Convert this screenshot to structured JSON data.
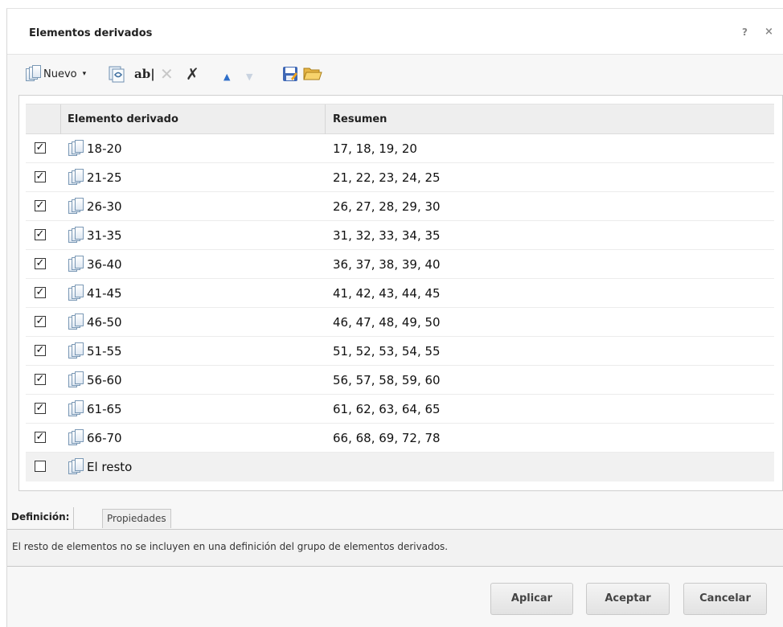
{
  "dialog": {
    "title": "Elementos derivados",
    "help_label": "?",
    "close_label": "×"
  },
  "toolbar": {
    "new_label": "Nuevo",
    "new_caret": "▾",
    "rename_icon": "ab|",
    "delete_icon": "✕",
    "delete_all_icon": "✗",
    "move_up_icon": "▲",
    "move_down_icon": "▼"
  },
  "grid": {
    "headers": {
      "name": "Elemento derivado",
      "summary": "Resumen"
    },
    "rows": [
      {
        "checked": true,
        "name": "18-20",
        "summary": "17, 18, 19, 20"
      },
      {
        "checked": true,
        "name": "21-25",
        "summary": "21, 22, 23, 24, 25"
      },
      {
        "checked": true,
        "name": "26-30",
        "summary": "26, 27, 28, 29, 30"
      },
      {
        "checked": true,
        "name": "31-35",
        "summary": "31, 32, 33, 34, 35"
      },
      {
        "checked": true,
        "name": "36-40",
        "summary": "36, 37, 38, 39, 40"
      },
      {
        "checked": true,
        "name": "41-45",
        "summary": "41, 42, 43, 44, 45"
      },
      {
        "checked": true,
        "name": "46-50",
        "summary": "46, 47, 48, 49, 50"
      },
      {
        "checked": true,
        "name": "51-55",
        "summary": "51, 52, 53, 54, 55"
      },
      {
        "checked": true,
        "name": "56-60",
        "summary": "56, 57, 58, 59, 60"
      },
      {
        "checked": true,
        "name": "61-65",
        "summary": "61, 62, 63, 64, 65"
      },
      {
        "checked": true,
        "name": "66-70",
        "summary": "66, 68, 69, 72, 78"
      },
      {
        "checked": false,
        "name": "El resto",
        "summary": ""
      }
    ]
  },
  "tabs": {
    "definition": "Definición:",
    "properties": "Propiedades"
  },
  "definition_text": "El resto de elementos no se incluyen en una definición del grupo de elementos derivados.",
  "buttons": {
    "apply": "Aplicar",
    "accept": "Aceptar",
    "cancel": "Cancelar"
  }
}
